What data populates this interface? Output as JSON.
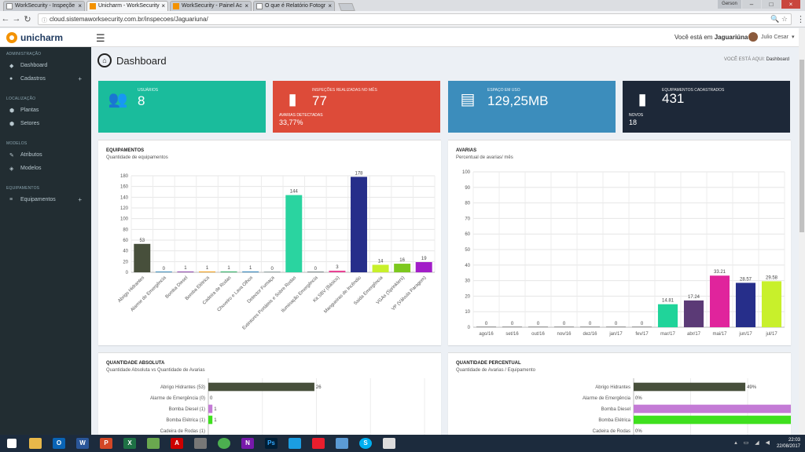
{
  "browser": {
    "tabs": [
      {
        "label": "WorkSecurity - Inspeçõe"
      },
      {
        "label": "Unicharm - WorkSecurity"
      },
      {
        "label": "WorkSecurity - Painel Ac"
      },
      {
        "label": "O que é Relatório Fotogr"
      }
    ],
    "user_badge": "Gerson",
    "url": "cloud.sistemaworksecurity.com.br/inspecoes/Jaguariuna/"
  },
  "header": {
    "logo": "unicharm",
    "location_prefix": "Você está em",
    "location": "Jaguariúna",
    "user": "Julio Cesar"
  },
  "sidebar": {
    "sections": [
      {
        "title": "ADMINISTRAÇÃO",
        "items": [
          {
            "label": "Dashboard",
            "icon": "dashboard-icon"
          },
          {
            "label": "Cadastros",
            "icon": "user-icon",
            "expand": "+"
          }
        ]
      },
      {
        "title": "LOCALIZAÇÃO",
        "items": [
          {
            "label": "Plantas",
            "icon": "map-pin-icon"
          },
          {
            "label": "Setores",
            "icon": "map-pin-icon"
          }
        ]
      },
      {
        "title": "MODELOS",
        "items": [
          {
            "label": "Atributos",
            "icon": "wrench-icon"
          },
          {
            "label": "Modelos",
            "icon": "cube-icon"
          }
        ]
      },
      {
        "title": "EQUIPAMENTOS",
        "items": [
          {
            "label": "Equipamentos",
            "icon": "list-icon",
            "expand": "+"
          }
        ]
      }
    ]
  },
  "page": {
    "title": "Dashboard",
    "breadcrumb_prefix": "VOCÊ ESTÁ AQUI:",
    "breadcrumb": "Dashboard"
  },
  "stats": [
    {
      "label": "USUÁRIOS",
      "value": "8",
      "color": "#1abc9c"
    },
    {
      "label": "INSPEÇÕES REALIZADAS NO MÊS",
      "value": "77",
      "sub_label": "AVARIAS DETECTADAS",
      "sub_value": "33,77%",
      "color": "#dd4b39"
    },
    {
      "label": "ESPAÇO EM USO",
      "value": "129,25MB",
      "color": "#3c8dbc"
    },
    {
      "label": "EQUIPAMENTOS CADASTRADOS",
      "value": "431",
      "sub_label": "NOVOS",
      "sub_value": "18",
      "color": "#1d2838"
    }
  ],
  "panels": {
    "equip": {
      "title": "EQUIPAMENTOS",
      "subtitle": "Quantidade de equipamentos"
    },
    "avarias": {
      "title": "AVARIAS",
      "subtitle": "Percentual de avarias/ mês"
    },
    "absoluta": {
      "title": "QUANTIDADE ABSOLUTA",
      "subtitle": "Quantidade Absoluta vs Quantidade de Avarias"
    },
    "percentual": {
      "title": "QUANTIDADE PERCENTUAL",
      "subtitle": "Quantidade de Avarias / Equipamento"
    }
  },
  "chart_data": [
    {
      "type": "bar",
      "categories": [
        "Abrigo Hidrantes",
        "Alarme de Emergência",
        "Bomba Diesel",
        "Bomba Elétrica",
        "Cadeira de Rodas",
        "Chuveiro e Lava Olhos",
        "Detector Fumaça",
        "Extintores Portáteis e Sobre Rodas",
        "Iluminação Emergência",
        "Kit SBV (Básico)",
        "Mangueiras de Incêndio",
        "Saída Emergência",
        "VGAs (Sprinklers)",
        "VP (Válvula Paragem)"
      ],
      "values": [
        53,
        0,
        1,
        1,
        1,
        1,
        0,
        144,
        0,
        3,
        178,
        14,
        16,
        19
      ],
      "colors": [
        "#474f3b",
        "#3c8dbc",
        "#8e44ad",
        "#f39c12",
        "#27ae60",
        "#2980b9",
        "#95a5a6",
        "#2ad4a0",
        "#7f8c8d",
        "#e84393",
        "#262e8a",
        "#c8f02b",
        "#7dc81e",
        "#a21ec8"
      ],
      "ylim": [
        0,
        180
      ],
      "yticks": [
        0,
        20,
        40,
        60,
        80,
        100,
        120,
        140,
        160,
        180
      ]
    },
    {
      "type": "bar",
      "categories": [
        "ago/16",
        "set/16",
        "out/16",
        "nov/16",
        "dez/16",
        "jan/17",
        "fev/17",
        "mar/17",
        "abr/17",
        "mai/17",
        "jun/17",
        "jul/17"
      ],
      "values": [
        0,
        0,
        0,
        0,
        0,
        0,
        0,
        14.81,
        17.24,
        33.21,
        28.57,
        29.58
      ],
      "labels": [
        "0",
        "0",
        "0",
        "0",
        "0",
        "0",
        "0",
        "14.81",
        "17.24",
        "33.21",
        "28.57",
        "29.58"
      ],
      "colors": [
        "#999",
        "#999",
        "#999",
        "#999",
        "#999",
        "#999",
        "#999",
        "#20d49a",
        "#5b3a76",
        "#e0249c",
        "#262e8a",
        "#c8f02b"
      ],
      "ylim": [
        0,
        100
      ],
      "yticks": [
        0,
        10,
        20,
        30,
        40,
        50,
        60,
        70,
        80,
        90,
        100
      ]
    },
    {
      "type": "bar",
      "orientation": "horizontal",
      "categories": [
        "Abrigo Hidrantes (53)",
        "Alarme de Emergência (0)",
        "Bomba Diesel (1)",
        "Bomba Elétrica (1)",
        "Cadeira de Rodas (1)"
      ],
      "values": [
        26,
        0,
        1,
        1,
        0
      ],
      "labels": [
        "26",
        "0",
        "1",
        "1",
        ""
      ],
      "colors": [
        "#474f3b",
        "#3c8dbc",
        "#c47bd6",
        "#3fe01e",
        "#27ae60"
      ],
      "xlim": [
        0,
        53
      ]
    },
    {
      "type": "bar",
      "orientation": "horizontal",
      "categories": [
        "Abrigo Hidrantes",
        "Alarme de Emergência",
        "Bomba Diesel",
        "Bomba Elétrica",
        "Cadeira de Rodas"
      ],
      "values": [
        49,
        0,
        100,
        100,
        0
      ],
      "labels": [
        "49%",
        "0%",
        "100%",
        "100%",
        "0%"
      ],
      "colors": [
        "#474f3b",
        "#3c8dbc",
        "#c47bd6",
        "#3fe01e",
        "#27ae60"
      ],
      "xlim": [
        0,
        100
      ]
    }
  ],
  "taskbar": {
    "time": "22:03",
    "date": "22/08/2017"
  }
}
